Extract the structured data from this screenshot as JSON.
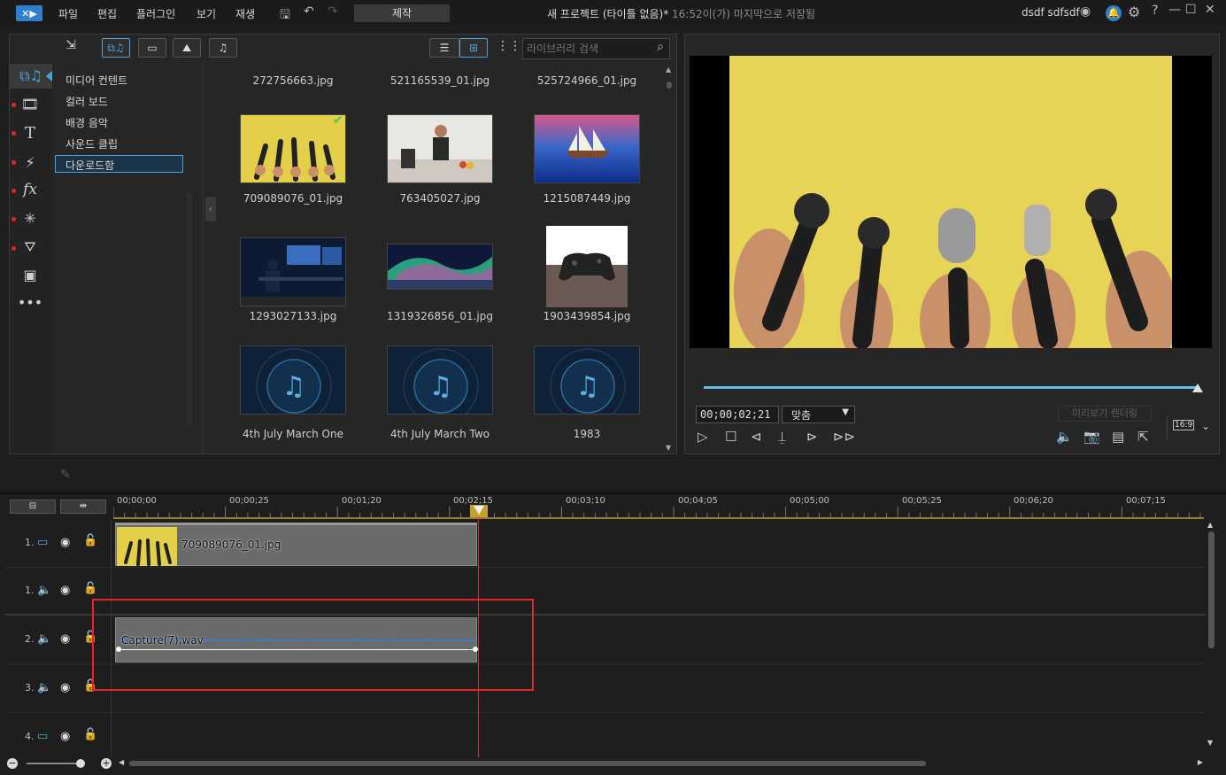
{
  "app": {
    "window_title": "새 프로젝트 (타이틀 없음)*",
    "save_status": "16:52이(가) 마지막으로 저장됨",
    "user": "dsdf sdfsdf",
    "mode_button": "제작"
  },
  "menu": [
    "파일",
    "편집",
    "플러그인",
    "보기",
    "재생"
  ],
  "library": {
    "search_placeholder": "라이브러리 검색",
    "categories": [
      "미디어 컨텐트",
      "컬러 보드",
      "배경 음악",
      "사운드 클립",
      "다운로드함"
    ],
    "selected_category": "다운로드함",
    "top_labels": [
      "272756663.jpg",
      "521165539_01.jpg",
      "525724966_01.jpg"
    ],
    "items": [
      {
        "label": "709089076_01.jpg",
        "kind": "mics"
      },
      {
        "label": "763405027.jpg",
        "kind": "kitchen"
      },
      {
        "label": "1215087449.jpg",
        "kind": "ship"
      },
      {
        "label": "1293027133.jpg",
        "kind": "desk"
      },
      {
        "label": "1319326856_01.jpg",
        "kind": "aurora"
      },
      {
        "label": "1903439854.jpg",
        "kind": "gamepad"
      },
      {
        "label": "4th July March One",
        "kind": "music"
      },
      {
        "label": "4th July March Two",
        "kind": "music"
      },
      {
        "label": "1983",
        "kind": "music"
      }
    ]
  },
  "preview": {
    "timecode": "00;00;02;21",
    "fit": "맞춤",
    "render_label": "미리보기 렌더링",
    "aspect": "16:9",
    "progress": 1.0
  },
  "timeline": {
    "ruler": [
      "00;00;00",
      "00;00;25",
      "00;01;20",
      "00;02;15",
      "00;03;10",
      "00;04;05",
      "00;05;00",
      "00;05;25",
      "00;06;20",
      "00;07;15"
    ],
    "tracks": [
      {
        "num": "1.",
        "type": "video"
      },
      {
        "num": "1.",
        "type": "audio"
      },
      {
        "num": "2.",
        "type": "audio"
      },
      {
        "num": "3.",
        "type": "audio"
      },
      {
        "num": "4.",
        "type": "video"
      }
    ],
    "clips": {
      "video": "709089076_01.jpg",
      "audio": "Capture(7).wav"
    }
  },
  "colors": {
    "accent": "#4aa3df",
    "highlight": "#e0262b",
    "playhead": "#c8a032"
  }
}
